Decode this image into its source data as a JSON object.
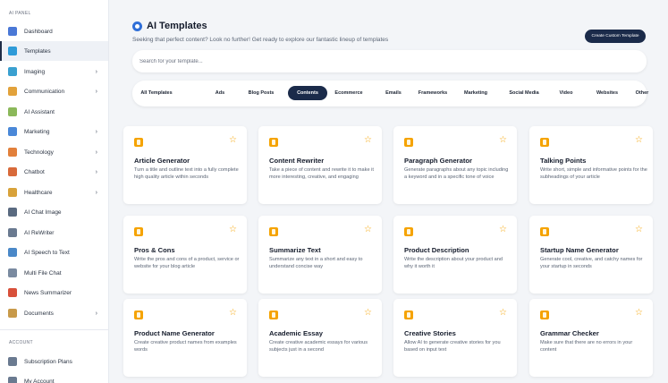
{
  "sidebar": {
    "section_main": "AI PANEL",
    "section_account": "ACCOUNT",
    "items": [
      {
        "label": "Dashboard",
        "icon": "dashboard-icon",
        "color": "#4a78d6",
        "chevron": false
      },
      {
        "label": "Templates",
        "icon": "templates-icon",
        "color": "#2f9bd8",
        "chevron": false
      },
      {
        "label": "Imaging",
        "icon": "imaging-icon",
        "color": "#3aa0d0",
        "chevron": true
      },
      {
        "label": "Communication",
        "icon": "communication-icon",
        "color": "#e2a23b",
        "chevron": true
      },
      {
        "label": "AI Assistant",
        "icon": "ai-assistant-icon",
        "color": "#8bb85a",
        "chevron": false
      },
      {
        "label": "Marketing",
        "icon": "marketing-icon",
        "color": "#4a88d8",
        "chevron": true
      },
      {
        "label": "Technology",
        "icon": "technology-icon",
        "color": "#e2803b",
        "chevron": true
      },
      {
        "label": "Chatbot",
        "icon": "chatbot-icon",
        "color": "#d86a3a",
        "chevron": true
      },
      {
        "label": "Healthcare",
        "icon": "healthcare-icon",
        "color": "#d8a23a",
        "chevron": true
      },
      {
        "label": "AI Chat Image",
        "icon": "chat-image-icon",
        "color": "#5a6a80",
        "chevron": false
      },
      {
        "label": "AI ReWriter",
        "icon": "rewriter-icon",
        "color": "#6a7a90",
        "chevron": false
      },
      {
        "label": "AI Speech to Text",
        "icon": "speech-icon",
        "color": "#4a88c8",
        "chevron": false
      },
      {
        "label": "Multi File Chat",
        "icon": "file-chat-icon",
        "color": "#7a8aa0",
        "chevron": false
      },
      {
        "label": "News Summarizer",
        "icon": "news-icon",
        "color": "#d8503a",
        "chevron": false
      },
      {
        "label": "Documents",
        "icon": "documents-icon",
        "color": "#c89a4a",
        "chevron": true
      }
    ],
    "account_items": [
      {
        "label": "Subscription Plans",
        "icon": "subscription-icon",
        "color": "#6a7a90"
      },
      {
        "label": "My Account",
        "icon": "account-icon",
        "color": "#6a7a90"
      }
    ]
  },
  "header": {
    "title": "AI Templates",
    "subtitle": "Seeking that perfect content? Look no further! Get ready to explore our fantastic lineup of templates",
    "create_button": "Create Custom Template"
  },
  "search": {
    "placeholder": "Search for your template..."
  },
  "filters": [
    "All Templates",
    "Ads",
    "Blog Posts",
    "Contents",
    "Ecommerce",
    "Emails",
    "Frameworks",
    "Marketing",
    "Social Media",
    "Video",
    "Websites",
    "Other"
  ],
  "active_filter": "Contents",
  "cards": [
    {
      "title": "Article Generator",
      "desc": "Turn a title and outline text into a fully complete high quality article within seconds",
      "icon": "document-icon"
    },
    {
      "title": "Content Rewriter",
      "desc": "Take a piece of content and rewrite it to make it more interesting, creative, and engaging",
      "icon": "rewrite-icon"
    },
    {
      "title": "Paragraph Generator",
      "desc": "Generate paragraphs about any topic including a keyword and in a specific tone of voice",
      "icon": "paragraph-icon"
    },
    {
      "title": "Talking Points",
      "desc": "Write short, simple and informative points for the subheadings of your article",
      "icon": "list-icon"
    },
    {
      "title": "Pros & Cons",
      "desc": "Write the pros and cons of a product, service or website for your blog article",
      "icon": "pros-cons-icon"
    },
    {
      "title": "Summarize Text",
      "desc": "Summarize any text in a short and easy to understand concise way",
      "icon": "summarize-icon"
    },
    {
      "title": "Product Description",
      "desc": "Write the description about your product and why it worth it",
      "icon": "product-icon"
    },
    {
      "title": "Startup Name Generator",
      "desc": "Generate cool, creative, and catchy names for your startup in seconds",
      "icon": "lightbulb-icon"
    },
    {
      "title": "Product Name Generator",
      "desc": "Create creative product names from examples words",
      "icon": "tag-icon"
    },
    {
      "title": "Academic Essay",
      "desc": "Create creative academic essays for various subjects just in a second",
      "icon": "essay-icon"
    },
    {
      "title": "Creative Stories",
      "desc": "Allow AI to generate creative stories for you based on input text",
      "icon": "story-icon"
    },
    {
      "title": "Grammar Checker",
      "desc": "Make sure that there are no errors in your content",
      "icon": "grammar-icon"
    }
  ],
  "colors": {
    "accent": "#1b2b4a",
    "icon_orange": "#f5a300",
    "brand_blue": "#2f6fd8"
  }
}
